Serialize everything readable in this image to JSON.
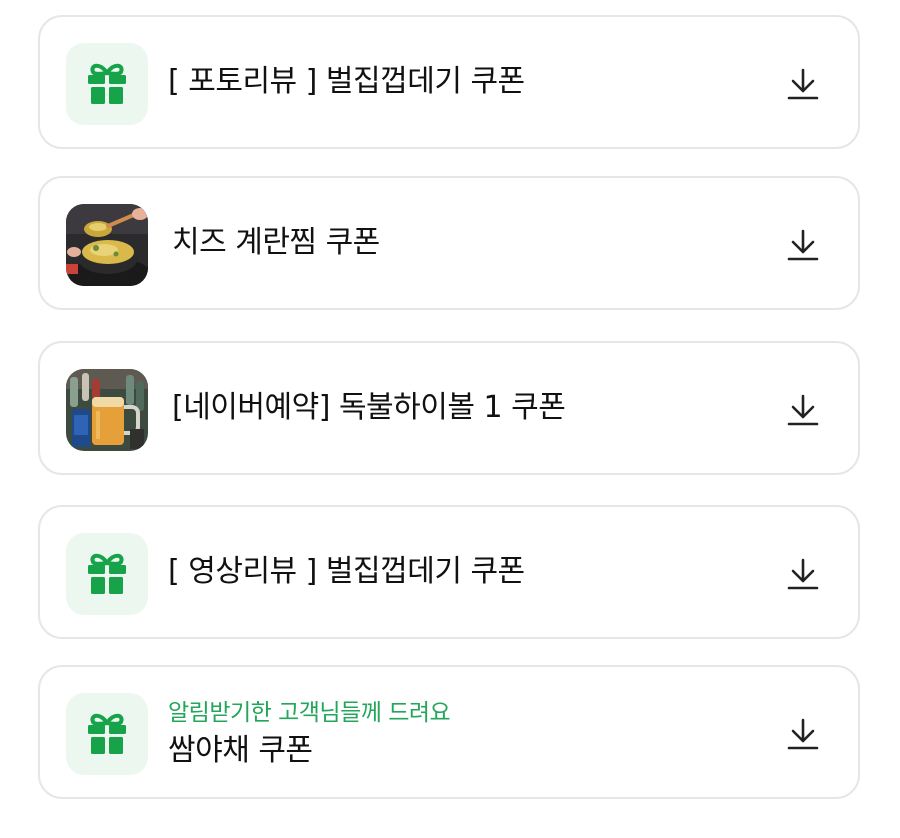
{
  "colors": {
    "accent_green": "#16a34a",
    "subtitle_green": "#22a65a",
    "gift_bg": "#ecf7f0",
    "card_border": "#e6e6e6"
  },
  "coupons": [
    {
      "title": "[ 포토리뷰 ] 벌집껍데기 쿠폰",
      "subtitle": "",
      "thumb": "gift-icon"
    },
    {
      "title": "치즈 계란찜 쿠폰",
      "subtitle": "",
      "thumb": "steamed-egg-photo"
    },
    {
      "title": "[네이버예약] 독불하이볼 1 쿠폰",
      "subtitle": "",
      "thumb": "highball-photo"
    },
    {
      "title": "[ 영상리뷰 ] 벌집껍데기 쿠폰",
      "subtitle": "",
      "thumb": "gift-icon"
    },
    {
      "title": "쌈야채 쿠폰",
      "subtitle": "알림받기한 고객님들께 드려요",
      "thumb": "gift-icon"
    }
  ]
}
